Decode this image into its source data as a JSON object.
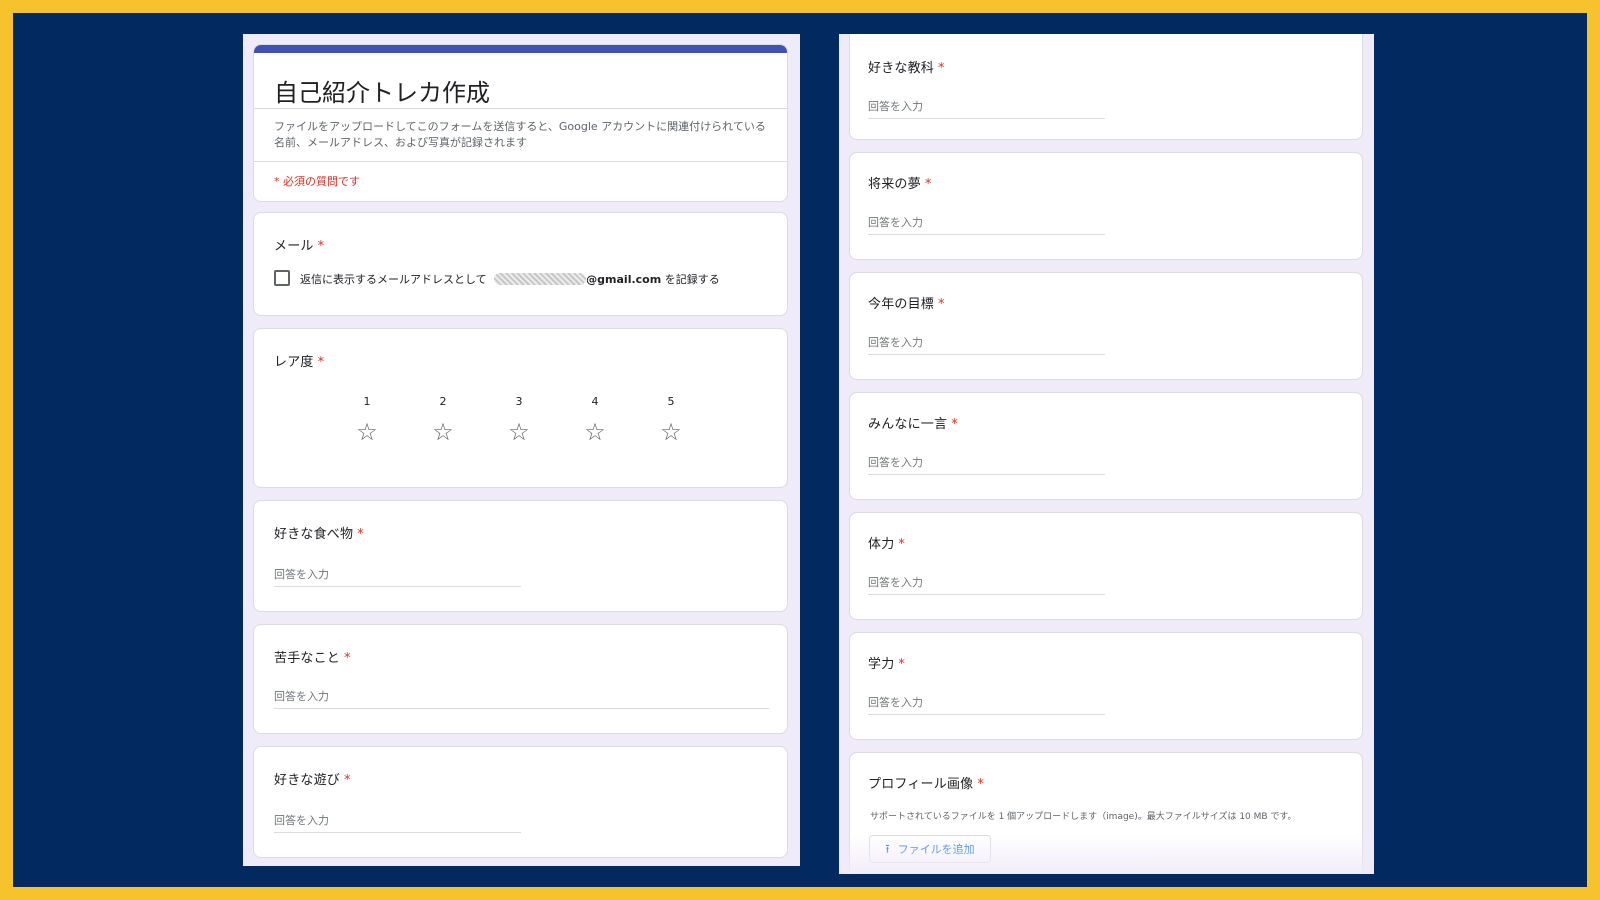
{
  "form": {
    "title": "自己紹介トレカ作成",
    "notice": "ファイルをアップロードしてこのフォームを送信すると、Google アカウントに関連付けられている名前、メールアドレス、および写真が記録されます",
    "required_note": "* 必須の質問です",
    "required_mark": "*",
    "placeholder": "回答を入力"
  },
  "email": {
    "label": "メール",
    "record_prefix": "返信に表示するメールアドレスとして",
    "email_suffix": "@gmail.com",
    "record_suffix": "を記録する",
    "checked": false
  },
  "rating": {
    "label": "レア度",
    "scale": [
      "1",
      "2",
      "3",
      "4",
      "5"
    ],
    "icon": "star-outline-icon"
  },
  "left_questions": [
    {
      "label": "好きな食べ物"
    },
    {
      "label": "苦手なこと"
    },
    {
      "label": "好きな遊び"
    }
  ],
  "right_questions": [
    {
      "label": "好きな教科"
    },
    {
      "label": "将来の夢"
    },
    {
      "label": "今年の目標"
    },
    {
      "label": "みんなに一言"
    },
    {
      "label": "体力"
    },
    {
      "label": "学力"
    }
  ],
  "upload": {
    "label": "プロフィール画像",
    "support_text": "サポートされているファイルを 1 個アップロードします（image)。最大ファイルサイズは 10 MB です。",
    "button_label": "ファイルを追加",
    "icon": "upload-icon"
  },
  "colors": {
    "frame": "#f6c32c",
    "background": "#032a60",
    "form_accent": "#3f51b5",
    "required": "#d93025",
    "link": "#1a73e8"
  }
}
